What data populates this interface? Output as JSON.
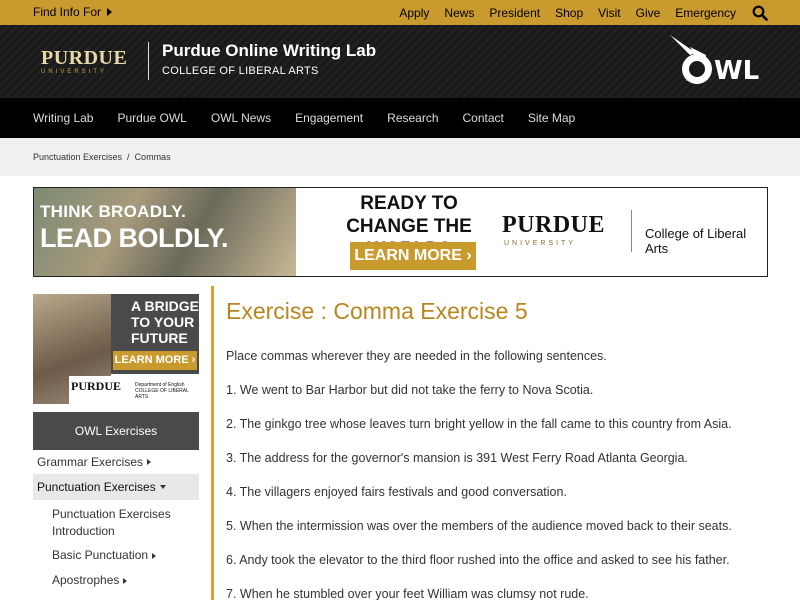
{
  "topbar": {
    "find_info": "Find Info For",
    "links": [
      "Apply",
      "News",
      "President",
      "Shop",
      "Visit",
      "Give",
      "Emergency"
    ],
    "search_icon": "search-icon"
  },
  "header": {
    "logo_word": "PURDUE",
    "logo_sub": "UNIVERSITY",
    "title": "Purdue Online Writing Lab",
    "subtitle": "COLLEGE OF LIBERAL ARTS",
    "owl_logo": "OWL"
  },
  "nav": [
    "Writing Lab",
    "Purdue OWL",
    "OWL News",
    "Engagement",
    "Research",
    "Contact",
    "Site Map"
  ],
  "breadcrumb": {
    "items": [
      "Punctuation Exercises",
      "Commas"
    ],
    "separator": "/"
  },
  "banner": {
    "line1": "THINK BROADLY.",
    "line2": "LEAD BOLDLY.",
    "headline": "READY TO CHANGE THE WORLD?",
    "cta": "LEARN MORE ›",
    "brand": "PURDUE",
    "brand_sub": "UNIVERSITY",
    "college": "College of Liberal Arts"
  },
  "side_ad": {
    "headline": "A BRIDGE TO YOUR FUTURE",
    "cta": "LEARN MORE ›",
    "brand": "PURDUE",
    "dept": "Department of English COLLEGE OF LIBERAL ARTS"
  },
  "sidemenu": {
    "heading": "OWL Exercises",
    "grammar": "Grammar Exercises",
    "punctuation": "Punctuation Exercises",
    "subs": {
      "intro": "Punctuation Exercises Introduction",
      "basic": "Basic Punctuation",
      "apostrophes": "Apostrophes"
    }
  },
  "main": {
    "title": "Exercise : Comma Exercise 5",
    "intro": "Place commas wherever they are needed in the following sentences.",
    "questions": [
      "1. We went to Bar Harbor but did not take the ferry to Nova Scotia.",
      "2. The ginkgo tree whose leaves turn bright yellow in the fall came to this country from Asia.",
      "3. The address for the governor's mansion is 391 West Ferry Road Atlanta Georgia.",
      "4. The villagers enjoyed fairs festivals and good conversation.",
      "5. When the intermission was over the members of the audience moved back to their seats.",
      "6. Andy took the elevator to the third floor rushed into the office and asked to see his father.",
      "7. When he stumbled over your feet William was clumsy not rude."
    ]
  },
  "colors": {
    "gold": "#c99a2e",
    "accent_line": "#e0a030",
    "title_gold": "#b8861e",
    "nav_bg": "#000000",
    "menu_head": "#4a4a4a"
  }
}
